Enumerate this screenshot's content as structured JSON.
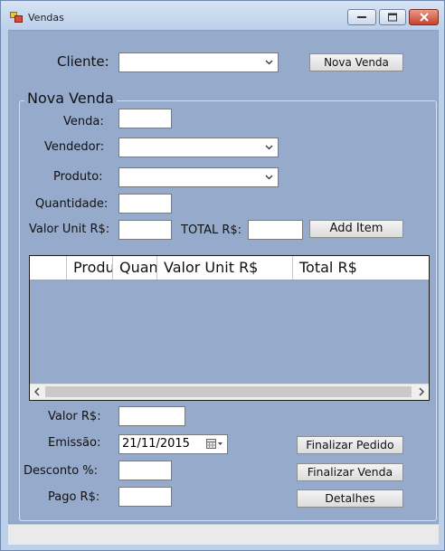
{
  "window": {
    "title": "Vendas"
  },
  "header": {
    "cliente_label": "Cliente:",
    "cliente_value": "",
    "nova_venda_button": "Nova Venda"
  },
  "group": {
    "title": "Nova Venda",
    "venda_label": "Venda:",
    "venda_value": "",
    "vendedor_label": "Vendedor:",
    "vendedor_value": "",
    "produto_label": "Produto:",
    "produto_value": "",
    "quantidade_label": "Quantidade:",
    "quantidade_value": "",
    "valor_unit_label": "Valor Unit R$:",
    "valor_unit_value": "",
    "total_label": "TOTAL R$:",
    "total_value": "",
    "add_item_button": "Add Item"
  },
  "grid": {
    "columns": [
      "",
      "Produto",
      "Quantidade",
      "Valor Unit R$",
      "Total R$"
    ],
    "rows": []
  },
  "bottom": {
    "valor_label": "Valor R$:",
    "valor_value": "",
    "emissao_label": "Emissão:",
    "emissao_value": "21/11/2015",
    "desconto_label": "Desconto %:",
    "desconto_value": "",
    "pago_label": "Pago R$:",
    "pago_value": "",
    "finalizar_pedido_button": "Finalizar Pedido",
    "finalizar_venda_button": "Finalizar Venda",
    "detalhes_button": "Detalhes"
  },
  "colors": {
    "client_bg": "#96abcb",
    "frame_bg": "#bdd0e9",
    "close_red": "#c7422b"
  },
  "icons": [
    "app-form-icon",
    "minimize-icon",
    "maximize-icon",
    "close-icon",
    "chevron-down-icon",
    "calendar-icon",
    "scroll-left-icon",
    "scroll-right-icon"
  ]
}
